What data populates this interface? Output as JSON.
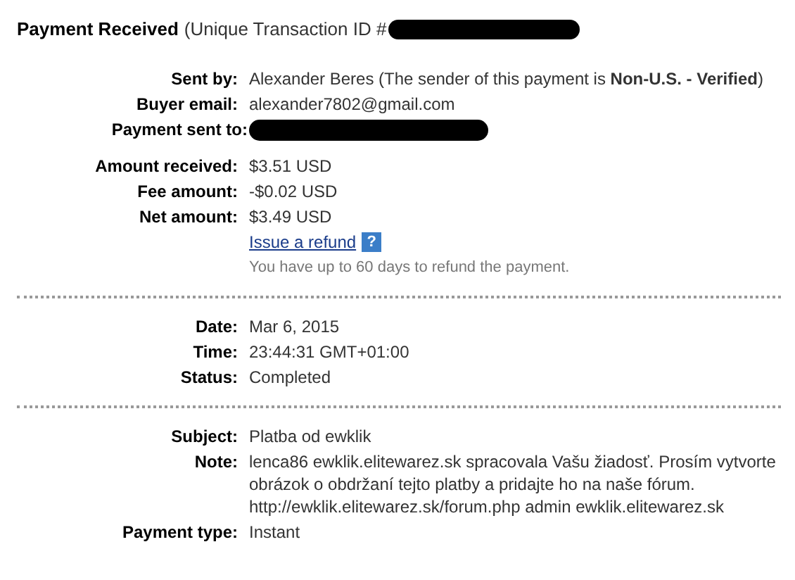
{
  "title": {
    "heading": "Payment Received",
    "transaction_prefix": "(Unique Transaction ID #",
    "redacted": true
  },
  "sections": [
    {
      "groups": [
        {
          "rows": [
            {
              "kind": "text",
              "label": "Sent by:",
              "value": "Alexander Beres (The sender of this payment is **Non-U.S. - Verified**)"
            },
            {
              "kind": "text",
              "label": "Buyer email:",
              "value": "alexander7802@gmail.com"
            },
            {
              "kind": "redacted",
              "label": "Payment sent to:"
            }
          ]
        },
        {
          "rows": [
            {
              "kind": "text",
              "label": "Amount received:",
              "value": "$3.51 USD"
            },
            {
              "kind": "text",
              "label": "Fee amount:",
              "value": "-$0.02 USD"
            },
            {
              "kind": "text",
              "label": "Net amount:",
              "value": "$3.49 USD"
            },
            {
              "kind": "refund",
              "link": "Issue a refund",
              "help": "?",
              "hint": "You have up to 60 days to refund the payment."
            }
          ]
        }
      ]
    },
    {
      "groups": [
        {
          "rows": [
            {
              "kind": "text",
              "label": "Date:",
              "value": "Mar 6, 2015"
            },
            {
              "kind": "text",
              "label": "Time:",
              "value": "23:44:31 GMT+01:00"
            },
            {
              "kind": "text",
              "label": "Status:",
              "value": "Completed"
            }
          ]
        }
      ]
    },
    {
      "groups": [
        {
          "rows": [
            {
              "kind": "text",
              "label": "Subject:",
              "value": "Platba od ewklik"
            },
            {
              "kind": "text",
              "label": "Note:",
              "value": "lenca86 ewklik.elitewarez.sk spracovala Vašu žiadosť. Prosím vytvorte obrázok o obdržaní tejto platby a pridajte ho na naše fórum. http://ewklik.elitewarez.sk/forum.php admin ewklik.elitewarez.sk"
            },
            {
              "kind": "text",
              "label": "Payment type:",
              "value": "Instant"
            }
          ]
        }
      ]
    }
  ]
}
